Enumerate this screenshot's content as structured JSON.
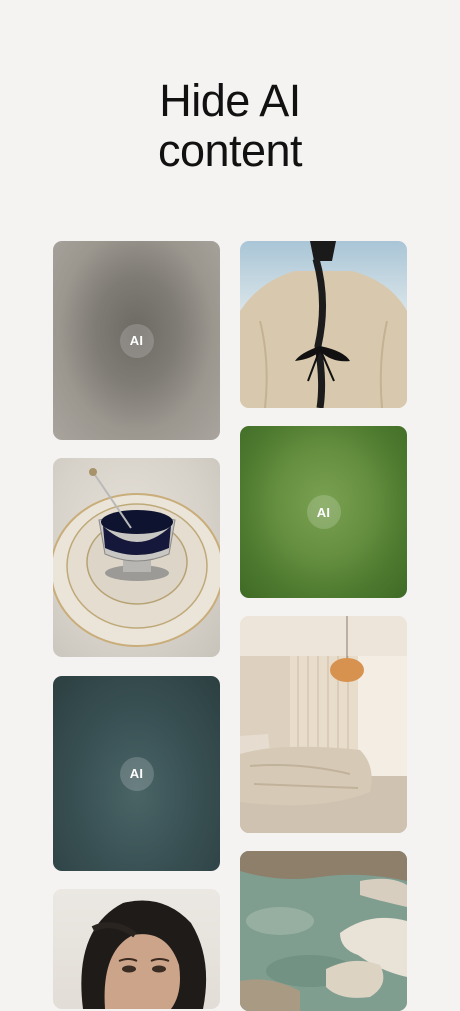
{
  "headline": {
    "line1": "Hide AI",
    "line2": "content"
  },
  "tiles": [
    {
      "label": "AI",
      "color": "#7f7b75"
    },
    {
      "description_icon": "photo-coat-braid"
    },
    {
      "description_icon": "photo-cup-plates"
    },
    {
      "label": "AI",
      "color": "#5f8a3a"
    },
    {
      "label": "AI",
      "color": "#3a5255"
    },
    {
      "description_icon": "photo-bedroom"
    },
    {
      "description_icon": "photo-portrait"
    },
    {
      "description_icon": "photo-rocks-water"
    }
  ]
}
